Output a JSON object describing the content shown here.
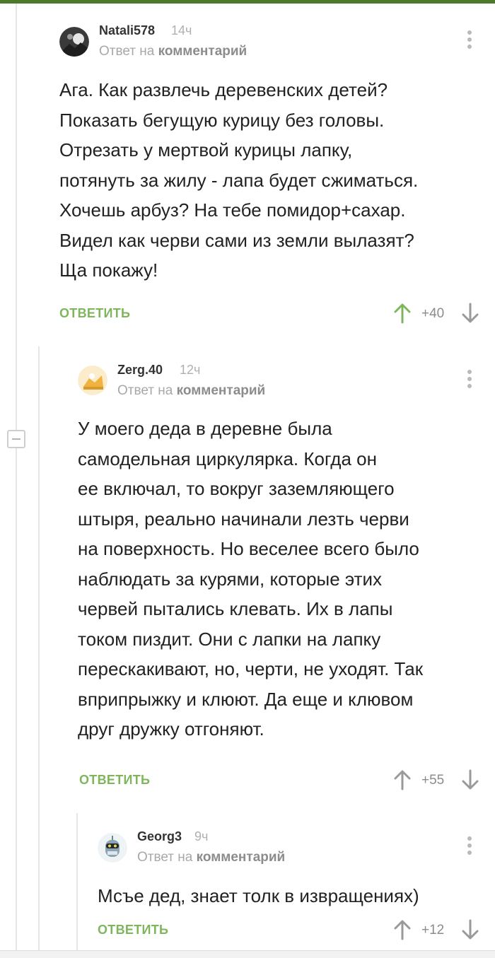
{
  "comments": [
    {
      "username": "Natali578",
      "time": "14ч",
      "reply_prefix": "Ответ на",
      "reply_target": "комментарий",
      "text": "Ага. Как развлечь деревенских детей?\nПоказать бегущую курицу без головы.\nОтрезать у мертвой курицы лапку,\nпотянуть за жилу - лапа будет сжиматься.\nХочешь арбуз? На тебе помидор+сахар.\nВидел как черви сами из земли вылазят?\nЩа покажу!",
      "reply_label": "ОТВЕТИТЬ",
      "rating": "+40"
    },
    {
      "username": "Zerg.40",
      "time": "12ч",
      "reply_prefix": "Ответ на",
      "reply_target": "комментарий",
      "text": "У моего деда в деревне была\nсамодельная циркулярка. Когда он\nее включал, то вокруг заземляющего\nштыря, реально начинали лезть черви\nна поверхность. Но веселее всего было\nнаблюдать за курями, которые этих\nчервей пытались клевать. Их в лапы\nтоком пиздит. Они с лапки на лапку\nперескакивают, но, черти, не уходят. Так\nвприпрыжку и клюют. Да еще и клювом\nдруг дружку отгоняют.",
      "reply_label": "ОТВЕТИТЬ",
      "rating": "+55"
    },
    {
      "username": "Georg3",
      "time": "9ч",
      "reply_prefix": "Ответ на",
      "reply_target": "комментарий",
      "text": "Мсъе дед, знает толк в извращениях)",
      "reply_label": "ОТВЕТИТЬ",
      "rating": "+12"
    }
  ],
  "colors": {
    "accent_green": "#7fb65c",
    "top_bar": "#4c7a2a",
    "muted_text": "#a8a8a8"
  },
  "icons": [
    "avatar-natali578",
    "avatar-zerg40",
    "avatar-georg3",
    "more-menu-icon",
    "arrow-up-icon",
    "arrow-down-icon",
    "collapse-icon"
  ]
}
